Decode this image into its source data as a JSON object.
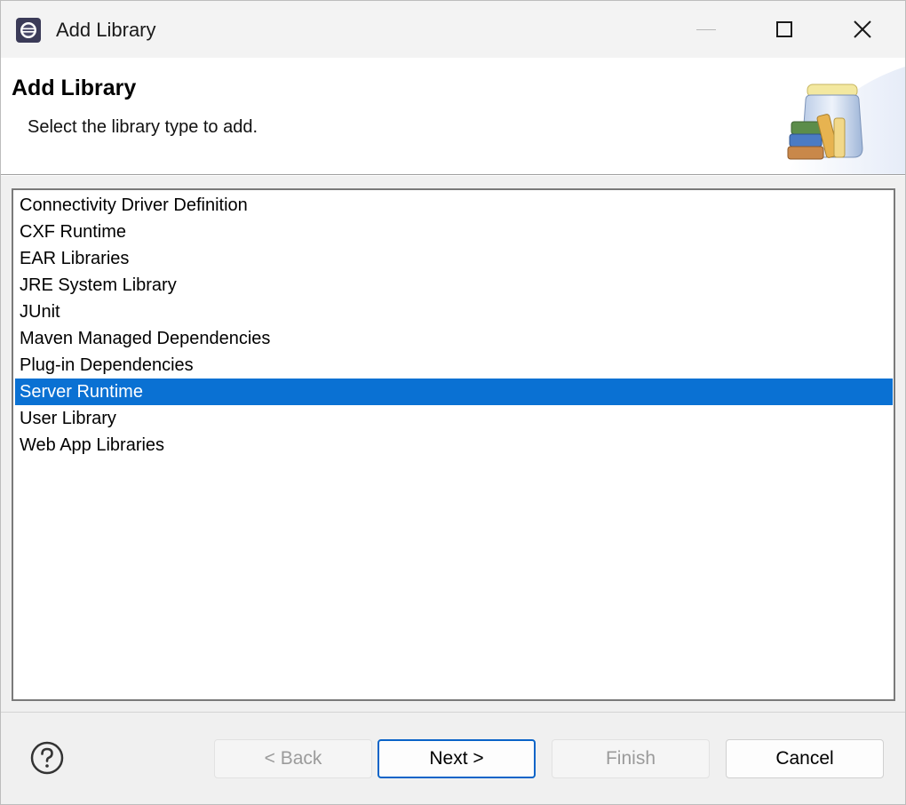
{
  "window": {
    "title": "Add Library"
  },
  "titlebar": {
    "icons": [
      "eclipse-app-icon",
      "minimize-icon",
      "maximize-icon",
      "close-icon"
    ]
  },
  "banner": {
    "title": "Add Library",
    "description": "Select the library type to add.",
    "icon": "library-jar-icon"
  },
  "library_types": {
    "selected_index": 7,
    "items": [
      "Connectivity Driver Definition",
      "CXF Runtime",
      "EAR Libraries",
      "JRE System Library",
      "JUnit",
      "Maven Managed Dependencies",
      "Plug-in Dependencies",
      "Server Runtime",
      "User Library",
      "Web App Libraries"
    ]
  },
  "footer": {
    "help_icon": "help-icon",
    "back_label": "< Back",
    "next_label": "Next >",
    "finish_label": "Finish",
    "cancel_label": "Cancel"
  },
  "colors": {
    "selection": "#0a71d3",
    "default_button_border": "#0a64c8",
    "disabled_text": "#9b9b9b"
  }
}
